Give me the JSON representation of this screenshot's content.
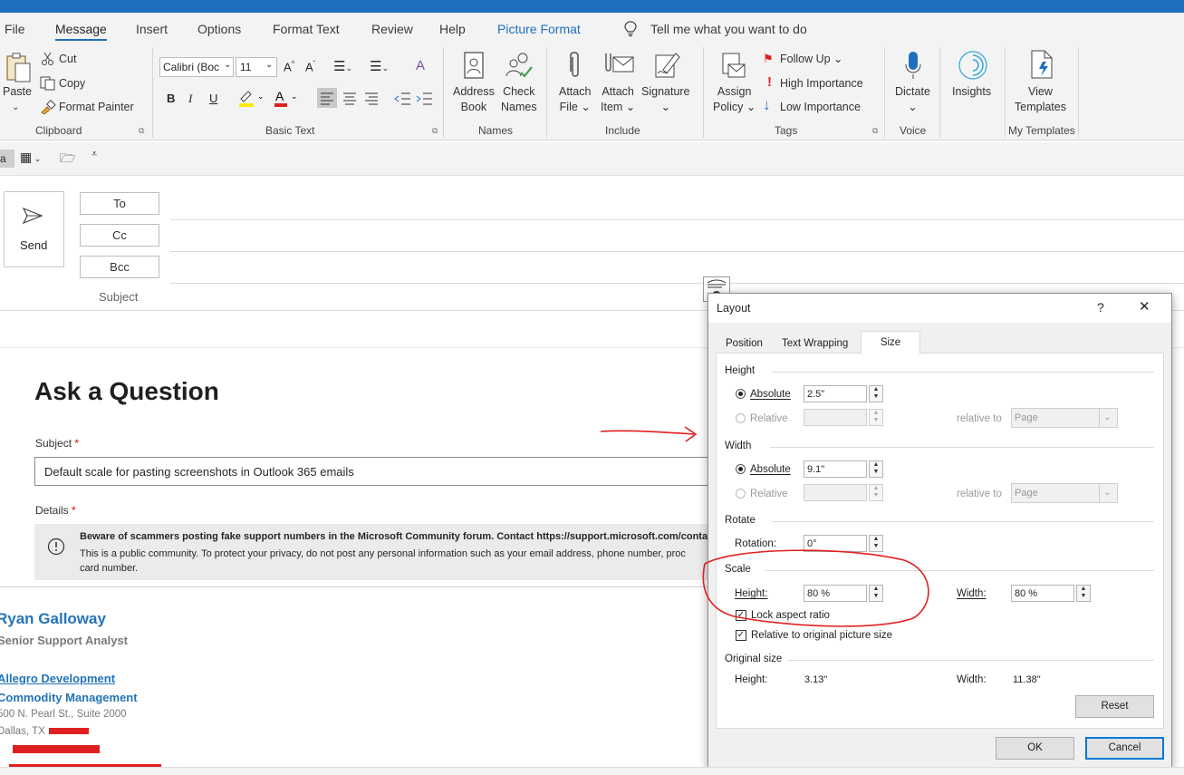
{
  "menu": {
    "file": "File",
    "message": "Message",
    "insert": "Insert",
    "options": "Options",
    "format_text": "Format Text",
    "review": "Review",
    "help": "Help",
    "picture_format": "Picture Format",
    "tell_me": "Tell me what you want to do"
  },
  "ribbon": {
    "clipboard": {
      "paste": "Paste",
      "cut": "Cut",
      "copy": "Copy",
      "format_painter": "Format Painter",
      "label": "Clipboard"
    },
    "basic_text": {
      "font_name": "Calibri (Boc",
      "font_size": "11",
      "label": "Basic Text"
    },
    "names": {
      "address_book_1": "Address",
      "address_book_2": "Book",
      "check_names_1": "Check",
      "check_names_2": "Names",
      "label": "Names"
    },
    "include": {
      "attach_file_1": "Attach",
      "attach_file_2": "File",
      "attach_item_1": "Attach",
      "attach_item_2": "Item",
      "signature": "Signature",
      "label": "Include"
    },
    "tags": {
      "assign_1": "Assign",
      "assign_2": "Policy",
      "follow_up": "Follow Up",
      "high": "High Importance",
      "low": "Low Importance",
      "label": "Tags"
    },
    "voice": {
      "dictate": "Dictate",
      "label": "Voice"
    },
    "insights": {
      "insights": "Insights"
    },
    "templates": {
      "view_1": "View",
      "view_2": "Templates",
      "label": "My Templates"
    }
  },
  "compose": {
    "send": "Send",
    "to": "To",
    "cc": "Cc",
    "bcc": "Bcc",
    "subject": "Subject"
  },
  "body": {
    "heading": "Ask a Question",
    "subject_label": "Subject",
    "required": "*",
    "subject_value": "Default scale for pasting screenshots in Outlook 365 emails",
    "details_label": "Details",
    "notice_bold": "Beware of scammers posting fake support numbers in the Microsoft Community forum. Contact https://support.microsoft.com/conta",
    "notice_line2": "This is a public community. To protect your privacy, do not post any personal information such as your email address, phone number, proc",
    "notice_line3": "card number.",
    "sig_name": "Ryan Galloway",
    "sig_title": "Senior Support Analyst",
    "sig_company": "Allegro Development",
    "sig_division": "Commodity Management",
    "sig_address": "500 N. Pearl St., Suite 2000",
    "sig_city": "Dallas, TX"
  },
  "dialog": {
    "title": "Layout",
    "help": "?",
    "close": "✕",
    "tabs": {
      "position": "Position",
      "text_wrapping": "Text Wrapping",
      "size": "Size"
    },
    "height_section": "Height",
    "width_section": "Width",
    "absolute": "Absolute",
    "relative": "Relative",
    "relative_to": "relative to",
    "page": "Page",
    "height_abs": "2.5\"",
    "width_abs": "9.1\"",
    "rotate_section": "Rotate",
    "rotation_label": "Rotation:",
    "rotation_value": "0°",
    "scale_section": "Scale",
    "scale_height_label": "Height:",
    "scale_height": "80 %",
    "scale_width_label": "Width:",
    "scale_width": "80 %",
    "lock_aspect": "Lock aspect ratio",
    "relative_original": "Relative to original picture size",
    "original_section": "Original size",
    "orig_height_label": "Height:",
    "orig_height": "3.13\"",
    "orig_width_label": "Width:",
    "orig_width": "11.38\"",
    "reset": "Reset",
    "ok": "OK",
    "cancel": "Cancel"
  },
  "colors": {
    "accent": "#1f6fc0",
    "annotation": "#e02020",
    "heading": "#1f1f1f",
    "signature_blue": "#2374b8"
  }
}
